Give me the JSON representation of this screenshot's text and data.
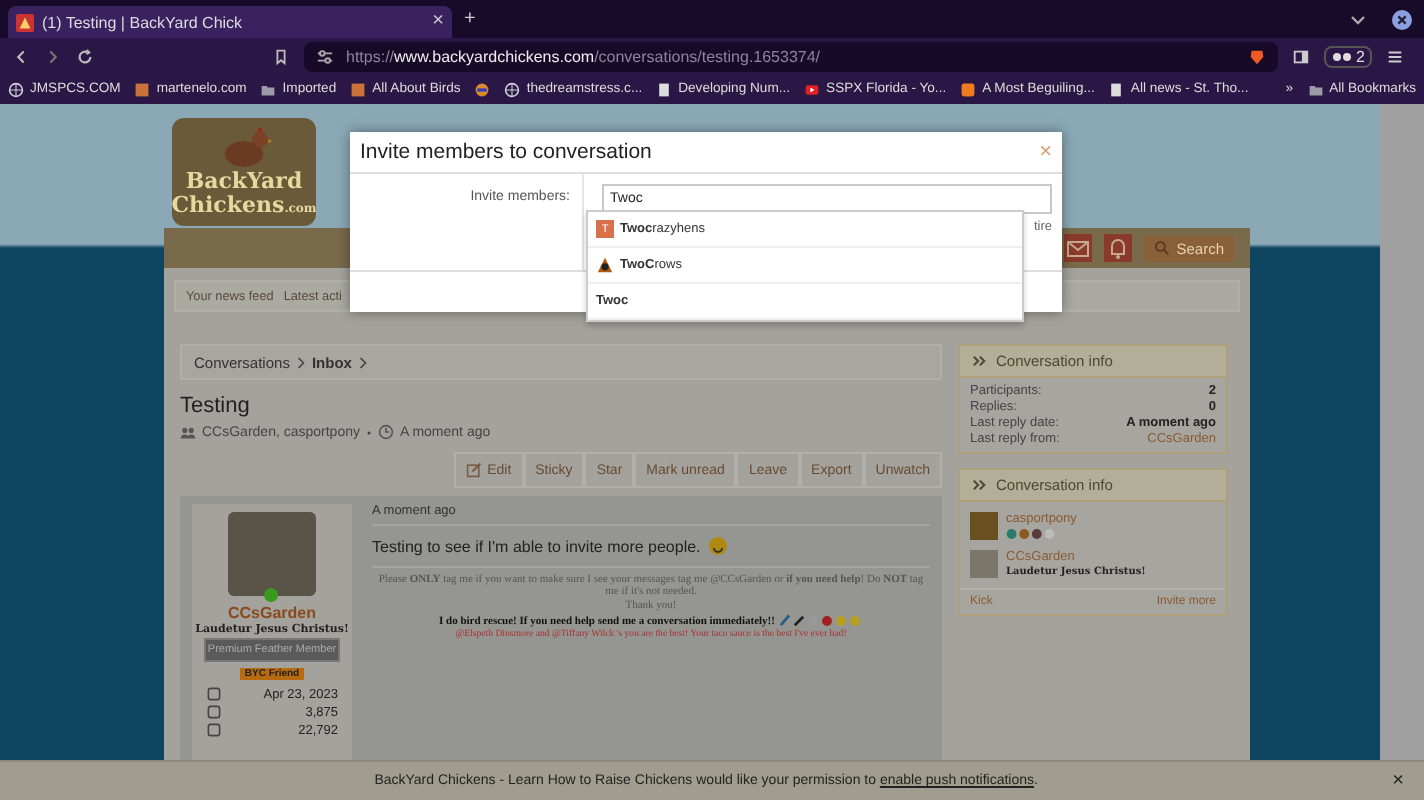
{
  "browser": {
    "tab": {
      "title": "(1) Testing | BackYard Chick",
      "close": "×"
    },
    "new_tab": "+",
    "url": {
      "scheme": "https://",
      "host": "www.backyardchickens.com",
      "path": "/conversations/testing.1653374/"
    },
    "profile_count": "2",
    "bookmarks": [
      {
        "label": "JMSPCS.COM",
        "kind": "globe"
      },
      {
        "label": "martenelo.com",
        "kind": "image"
      },
      {
        "label": "Imported",
        "kind": "folder"
      },
      {
        "label": "All About Birds",
        "kind": "image"
      },
      {
        "kind": "circle"
      },
      {
        "label": "thedreamstress.c...",
        "kind": "globe"
      },
      {
        "label": "Developing Num...",
        "kind": "page"
      },
      {
        "label": "SSPX Florida - Yo...",
        "kind": "video"
      },
      {
        "label": "A Most Beguiling...",
        "kind": "blog"
      },
      {
        "label": "All news - St. Tho...",
        "kind": "page"
      }
    ],
    "overflow": "»",
    "all_bookmarks": "All Bookmarks"
  },
  "site": {
    "logo": {
      "line1": "BackYard",
      "line2": "Chickens",
      "suffix": ".com"
    },
    "search_button": "Search",
    "subnav": [
      "Your news feed",
      "Latest acti"
    ]
  },
  "breadcrumb": [
    {
      "label": "Conversations",
      "current": false
    },
    {
      "label": "Inbox",
      "current": true
    }
  ],
  "conversation": {
    "title": "Testing",
    "participants": "CCsGarden, casportpony",
    "time": "A moment ago",
    "actions": [
      "Edit",
      "Sticky",
      "Star",
      "Mark unread",
      "Leave",
      "Export",
      "Unwatch"
    ]
  },
  "message": {
    "time": "A moment ago",
    "text": "Testing to see if I'm able to invite more people.",
    "author": {
      "name": "CCsGarden",
      "online": true,
      "motto": "Laudetur Jesus Christus!",
      "rank": "Premium Feather Member",
      "badge": "BYC Friend",
      "stats": [
        "Apr 23, 2023",
        "3,875",
        "22,792"
      ]
    },
    "signature": [
      {
        "kind": "plain",
        "text": "Please **ONLY** tag me if you want to make sure I see your messages tag me @CCsGarden or **if you need help**! Do **NOT** tag me if it's not needed."
      },
      {
        "kind": "plain",
        "text": "Thank you!"
      },
      {
        "kind": "bold",
        "text": "I do bird rescue! If you need help send me a conversation immediately!!"
      },
      {
        "kind": "red",
        "text": "@Elspeth Dinsmore and @Tiffany Wilck 's you are the best! Your taco sauce is the best I've ever had!"
      }
    ]
  },
  "sidebar": [
    {
      "title": "Conversation info",
      "rows": [
        {
          "label": "Participants:",
          "value": "2",
          "link": false
        },
        {
          "label": "Replies:",
          "value": "0",
          "link": false
        },
        {
          "label": "Last reply date:",
          "value": "A moment ago",
          "link": false
        },
        {
          "label": "Last reply from:",
          "value": "CCsGarden",
          "link": true
        }
      ]
    },
    {
      "title": "Conversation info",
      "members": [
        {
          "name": "casportpony",
          "kind": "icons"
        },
        {
          "name": "CCsGarden",
          "kind": "motto",
          "motto": "Laudetur Jesus Christus!"
        }
      ],
      "footer": [
        "Kick",
        "Invite more"
      ]
    }
  ],
  "modal": {
    "title": "Invite members to conversation",
    "close": "×",
    "label": "Invite members:",
    "value": "Twoc",
    "behind_hint": "tire",
    "suggestions": [
      {
        "text": "**Twoc**razyhens",
        "kind": "letter",
        "letter": "T"
      },
      {
        "text": "**TwoC**rows",
        "kind": "image"
      },
      {
        "text": "**Twoc**",
        "kind": "plain"
      }
    ]
  },
  "notification": {
    "text": "BackYard Chickens - Learn How to Raise Chickens would like your permission to",
    "link": "enable push notifications",
    "end": ".",
    "close": "×"
  }
}
